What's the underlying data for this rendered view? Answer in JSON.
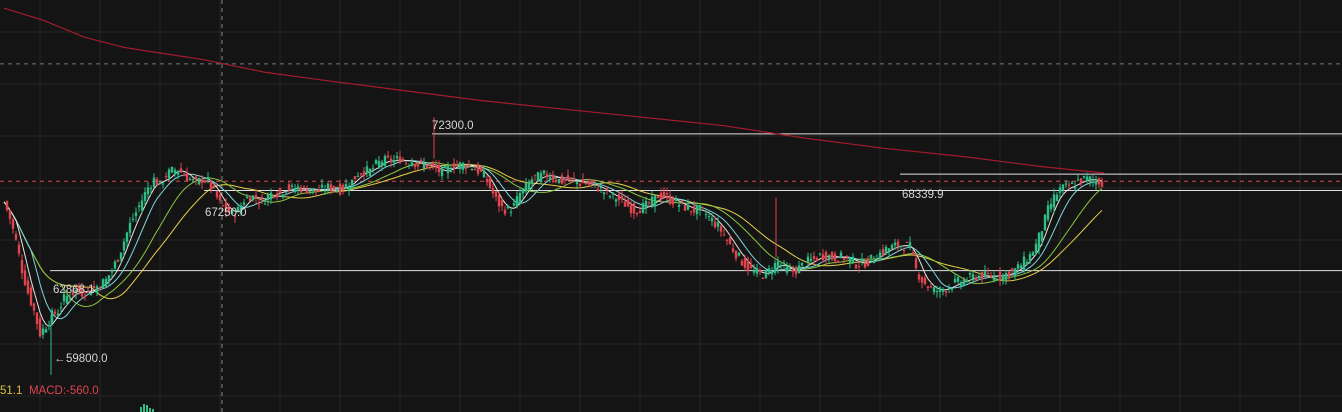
{
  "colors": {
    "background": "#141414",
    "grid": "#262626",
    "up": "#2ebd85",
    "down": "#e0454f",
    "ma_white": "#e6e6e6",
    "ma_cyan": "#7fd6e0",
    "ma_green": "#8cc63f",
    "ma_yellow": "#e7d04a",
    "ma_long": "#a31c2c",
    "level_line": "#e0e0e0",
    "dashed_red": "#d84a4a",
    "dashed_gray": "#7a7a7a"
  },
  "chart_data": {
    "type": "candlestick",
    "y_range": [
      58000,
      78000
    ],
    "annotations": {
      "high": "72300.0",
      "low": "59800.0",
      "mark_a": "67250.0",
      "mark_b": "62868.1",
      "mark_c": "68339.9",
      "low_arrow": "←"
    },
    "levels": [
      71500,
      69550,
      68750,
      64860
    ],
    "dashed_levels": [
      {
        "value": 74900,
        "color": "gray"
      },
      {
        "value": 69200,
        "color": "red"
      }
    ],
    "close_points": [
      [
        0,
        68200
      ],
      [
        6,
        67400
      ],
      [
        12,
        66300
      ],
      [
        18,
        64900
      ],
      [
        24,
        63800
      ],
      [
        30,
        62900
      ],
      [
        36,
        61800
      ],
      [
        42,
        62200
      ],
      [
        48,
        62700
      ],
      [
        54,
        62900
      ],
      [
        60,
        63500
      ],
      [
        66,
        63700
      ],
      [
        72,
        63900
      ],
      [
        78,
        63800
      ],
      [
        84,
        63900
      ],
      [
        90,
        64000
      ],
      [
        96,
        64200
      ],
      [
        102,
        64400
      ],
      [
        108,
        64900
      ],
      [
        114,
        65500
      ],
      [
        120,
        66300
      ],
      [
        126,
        67100
      ],
      [
        132,
        67700
      ],
      [
        138,
        68300
      ],
      [
        144,
        68900
      ],
      [
        150,
        69300
      ],
      [
        156,
        69000
      ],
      [
        162,
        69500
      ],
      [
        168,
        69700
      ],
      [
        174,
        69800
      ],
      [
        180,
        69500
      ],
      [
        186,
        69300
      ],
      [
        192,
        69100
      ],
      [
        198,
        69300
      ],
      [
        204,
        69200
      ],
      [
        210,
        68700
      ],
      [
        216,
        68100
      ],
      [
        222,
        67800
      ],
      [
        228,
        67600
      ],
      [
        234,
        67800
      ],
      [
        240,
        68300
      ],
      [
        246,
        68500
      ],
      [
        252,
        68400
      ],
      [
        258,
        68200
      ],
      [
        264,
        68500
      ],
      [
        270,
        68700
      ],
      [
        276,
        68600
      ],
      [
        282,
        68900
      ],
      [
        288,
        68800
      ],
      [
        294,
        68900
      ],
      [
        300,
        68800
      ],
      [
        306,
        68800
      ],
      [
        312,
        68700
      ],
      [
        318,
        68800
      ],
      [
        324,
        68900
      ],
      [
        330,
        68900
      ],
      [
        336,
        68800
      ],
      [
        342,
        69000
      ],
      [
        348,
        69200
      ],
      [
        354,
        69600
      ],
      [
        360,
        69700
      ],
      [
        366,
        69700
      ],
      [
        372,
        70000
      ],
      [
        378,
        70200
      ],
      [
        384,
        70200
      ],
      [
        390,
        70200
      ],
      [
        396,
        70300
      ],
      [
        402,
        70100
      ],
      [
        408,
        70200
      ],
      [
        414,
        70000
      ],
      [
        420,
        70000
      ],
      [
        426,
        69900
      ],
      [
        432,
        69800
      ],
      [
        438,
        69600
      ],
      [
        444,
        69800
      ],
      [
        450,
        70000
      ],
      [
        456,
        70000
      ],
      [
        462,
        70000
      ],
      [
        468,
        69900
      ],
      [
        474,
        69700
      ],
      [
        480,
        69500
      ],
      [
        486,
        68900
      ],
      [
        492,
        68300
      ],
      [
        498,
        67900
      ],
      [
        504,
        67800
      ],
      [
        510,
        68000
      ],
      [
        516,
        68600
      ],
      [
        522,
        68900
      ],
      [
        528,
        69300
      ],
      [
        534,
        69400
      ],
      [
        540,
        69500
      ],
      [
        546,
        69500
      ],
      [
        552,
        69300
      ],
      [
        558,
        69200
      ],
      [
        564,
        69300
      ],
      [
        570,
        69200
      ],
      [
        576,
        69100
      ],
      [
        582,
        69100
      ],
      [
        588,
        69000
      ],
      [
        594,
        68900
      ],
      [
        600,
        68700
      ],
      [
        606,
        68500
      ],
      [
        612,
        68400
      ],
      [
        618,
        68200
      ],
      [
        624,
        68000
      ],
      [
        630,
        67800
      ],
      [
        636,
        67900
      ],
      [
        642,
        68000
      ],
      [
        648,
        68200
      ],
      [
        654,
        68500
      ],
      [
        660,
        68500
      ],
      [
        666,
        68300
      ],
      [
        672,
        68200
      ],
      [
        678,
        68000
      ],
      [
        684,
        67900
      ],
      [
        690,
        67800
      ],
      [
        696,
        67800
      ],
      [
        702,
        67600
      ],
      [
        708,
        67300
      ],
      [
        714,
        67000
      ],
      [
        720,
        66600
      ],
      [
        726,
        66100
      ],
      [
        732,
        65700
      ],
      [
        738,
        65300
      ],
      [
        744,
        65000
      ],
      [
        750,
        64800
      ],
      [
        756,
        64700
      ],
      [
        762,
        64700
      ],
      [
        768,
        65000
      ],
      [
        774,
        65300
      ],
      [
        780,
        65000
      ],
      [
        786,
        64800
      ],
      [
        792,
        64900
      ],
      [
        798,
        65100
      ],
      [
        804,
        65300
      ],
      [
        810,
        65400
      ],
      [
        816,
        65600
      ],
      [
        822,
        65600
      ],
      [
        828,
        65500
      ],
      [
        834,
        65500
      ],
      [
        840,
        65500
      ],
      [
        846,
        65400
      ],
      [
        852,
        65200
      ],
      [
        858,
        65200
      ],
      [
        864,
        65300
      ],
      [
        870,
        65500
      ],
      [
        876,
        65700
      ],
      [
        882,
        65900
      ],
      [
        888,
        66000
      ],
      [
        894,
        66100
      ],
      [
        900,
        66100
      ],
      [
        906,
        66000
      ],
      [
        912,
        64900
      ],
      [
        918,
        64400
      ],
      [
        924,
        64100
      ],
      [
        930,
        63900
      ],
      [
        936,
        63900
      ],
      [
        942,
        64000
      ],
      [
        948,
        64200
      ],
      [
        954,
        64300
      ],
      [
        960,
        64400
      ],
      [
        966,
        64500
      ],
      [
        972,
        64600
      ],
      [
        978,
        64600
      ],
      [
        984,
        64600
      ],
      [
        990,
        64600
      ],
      [
        996,
        64600
      ],
      [
        1002,
        64700
      ],
      [
        1008,
        64800
      ],
      [
        1014,
        65000
      ],
      [
        1020,
        65300
      ],
      [
        1026,
        65600
      ],
      [
        1032,
        66100
      ],
      [
        1038,
        66900
      ],
      [
        1044,
        67800
      ],
      [
        1050,
        68400
      ],
      [
        1056,
        68800
      ],
      [
        1062,
        68900
      ],
      [
        1068,
        69000
      ],
      [
        1074,
        69200
      ],
      [
        1080,
        69300
      ],
      [
        1086,
        69300
      ],
      [
        1092,
        69200
      ],
      [
        1098,
        69150
      ]
    ],
    "long_ma_points": [
      [
        0,
        77600
      ],
      [
        40,
        77000
      ],
      [
        80,
        76200
      ],
      [
        120,
        75700
      ],
      [
        160,
        75400
      ],
      [
        200,
        75100
      ],
      [
        220,
        74900
      ],
      [
        260,
        74500
      ],
      [
        320,
        74100
      ],
      [
        400,
        73600
      ],
      [
        480,
        73100
      ],
      [
        560,
        72700
      ],
      [
        640,
        72300
      ],
      [
        720,
        71900
      ],
      [
        800,
        71300
      ],
      [
        880,
        70800
      ],
      [
        960,
        70400
      ],
      [
        1040,
        69900
      ],
      [
        1100,
        69600
      ]
    ],
    "indicator_partial": "51.1",
    "indicator_macd": "MACD:-560.0"
  }
}
